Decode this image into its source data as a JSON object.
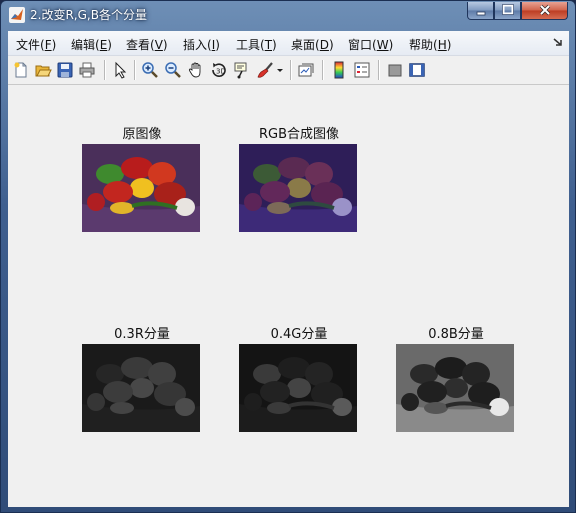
{
  "window": {
    "title": "2.改变R,G,B各个分量"
  },
  "menu": {
    "items": [
      {
        "label": "文件(",
        "key": "F",
        "end": ")"
      },
      {
        "label": "编辑(",
        "key": "E",
        "end": ")"
      },
      {
        "label": "查看(",
        "key": "V",
        "end": ")"
      },
      {
        "label": "插入(",
        "key": "I",
        "end": ")"
      },
      {
        "label": "工具(",
        "key": "T",
        "end": ")"
      },
      {
        "label": "桌面(",
        "key": "D",
        "end": ")"
      },
      {
        "label": "窗口(",
        "key": "W",
        "end": ")"
      },
      {
        "label": "帮助(",
        "key": "H",
        "end": ")"
      }
    ]
  },
  "toolbar": {
    "icons": [
      "new-figure-icon",
      "open-file-icon",
      "save-icon",
      "print-icon",
      "edit-plot-arrow-icon",
      "zoom-in-icon",
      "zoom-out-icon",
      "pan-hand-icon",
      "rotate-3d-icon",
      "data-cursor-icon",
      "brush-icon",
      "brush-dropdown-icon",
      "link-plot-icon",
      "colorbar-icon",
      "legend-icon",
      "hide-plot-tools-icon",
      "show-plot-tools-icon"
    ]
  },
  "subplots": {
    "original": {
      "title": "原图像"
    },
    "rgb": {
      "title": "RGB合成图像"
    },
    "r": {
      "title": "0.3R分量"
    },
    "g": {
      "title": "0.4G分量"
    },
    "b": {
      "title": "0.8B分量"
    }
  },
  "colors": {
    "title_bar": "#3f5f8f",
    "client_bg": "#f0f0f0",
    "close_button": "#c9452c"
  }
}
